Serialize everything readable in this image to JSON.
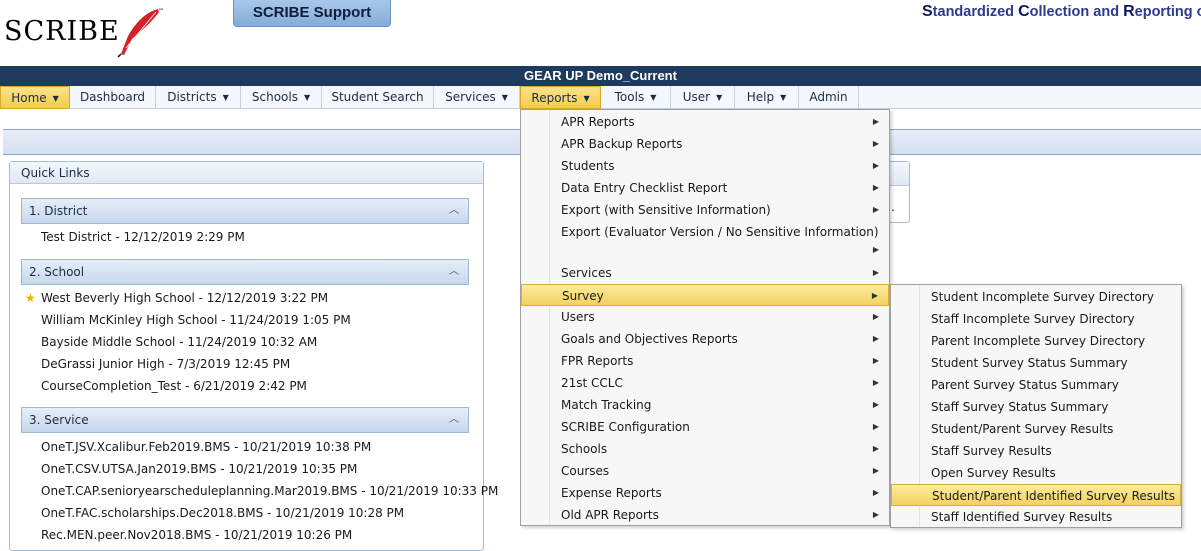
{
  "header": {
    "logo_text": "SCRIBE",
    "logo_tm": "™",
    "support_label": "SCRIBE Support",
    "tagline": [
      {
        "cap": "S",
        "rest": "tandardized "
      },
      {
        "cap": "C",
        "rest": "ollection and "
      },
      {
        "cap": "R",
        "rest": "eporting o"
      }
    ]
  },
  "title": "GEAR UP Demo_Current",
  "nav": {
    "items": [
      {
        "label": "Home",
        "arrow": "▼"
      },
      {
        "label": "Dashboard",
        "arrow": ""
      },
      {
        "label": "Districts",
        "arrow": "▼"
      },
      {
        "label": "Schools",
        "arrow": "▼"
      },
      {
        "label": "Student Search",
        "arrow": ""
      },
      {
        "label": "Services",
        "arrow": "▼"
      },
      {
        "label": "Reports",
        "arrow": "▼"
      },
      {
        "label": "Tools",
        "arrow": "▼"
      },
      {
        "label": "User",
        "arrow": "▼"
      },
      {
        "label": "Help",
        "arrow": "▼"
      },
      {
        "label": "Admin",
        "arrow": ""
      }
    ]
  },
  "quick_links": {
    "title": "Quick Links",
    "sections": [
      {
        "title": "1. District",
        "items": [
          "Test District - 12/12/2019 2:29 PM"
        ]
      },
      {
        "title": "2. School",
        "items": [
          "West Beverly High School - 12/12/2019 3:22 PM",
          "William McKinley High School - 11/24/2019 1:05 PM",
          "Bayside Middle School - 11/24/2019 10:32 AM",
          "DeGrassi Junior High - 7/3/2019 12:45 PM",
          "CourseCompletion_Test - 6/21/2019 2:42 PM"
        ]
      },
      {
        "title": "3. Service",
        "items": [
          "OneT.JSV.Xcalibur.Feb2019.BMS - 10/21/2019 10:38 PM",
          "OneT.CSV.UTSA.Jan2019.BMS - 10/21/2019 10:35 PM",
          "OneT.CAP.senioryearscheduleplanning.Mar2019.BMS - 10/21/2019 10:33 PM",
          "OneT.FAC.scholarships.Dec2018.BMS - 10/21/2019 10:28 PM",
          "Rec.MEN.peer.Nov2018.BMS - 10/21/2019 10:26 PM"
        ]
      }
    ],
    "collapse_glyph": "︿",
    "star_glyph": "★"
  },
  "behind_panel": {
    "trailing_text": "."
  },
  "reports_menu": {
    "items": [
      {
        "label": "APR Reports",
        "arrow": "▶"
      },
      {
        "label": "APR Backup Reports",
        "arrow": "▶"
      },
      {
        "label": "Students",
        "arrow": "▶"
      },
      {
        "label": "Data Entry Checklist Report",
        "arrow": "▶"
      },
      {
        "label": "Export (with Sensitive Information)",
        "arrow": "▶"
      },
      {
        "label": "Export (Evaluator Version / No Sensitive Information)",
        "arrow": ""
      },
      {
        "label": "",
        "arrow": "▶"
      },
      {
        "label": "Services",
        "arrow": "▶"
      },
      {
        "label": "Survey",
        "arrow": "▶"
      },
      {
        "label": "Users",
        "arrow": "▶"
      },
      {
        "label": "Goals and Objectives Reports",
        "arrow": "▶"
      },
      {
        "label": "FPR Reports",
        "arrow": "▶"
      },
      {
        "label": "21st CCLC",
        "arrow": "▶"
      },
      {
        "label": "Match Tracking",
        "arrow": "▶"
      },
      {
        "label": "SCRIBE Configuration",
        "arrow": "▶"
      },
      {
        "label": "Schools",
        "arrow": "▶"
      },
      {
        "label": "Courses",
        "arrow": "▶"
      },
      {
        "label": "Expense Reports",
        "arrow": "▶"
      },
      {
        "label": "Old APR Reports",
        "arrow": "▶"
      }
    ]
  },
  "survey_menu": {
    "items": [
      "Student Incomplete Survey Directory",
      "Staff Incomplete Survey Directory",
      "Parent Incomplete Survey Directory",
      "Student Survey Status Summary",
      "Parent Survey Status Summary",
      "Staff Survey Status Summary",
      "Student/Parent Survey Results",
      "Staff Survey Results",
      "Open Survey Results",
      "Student/Parent Identified Survey Results",
      "Staff Identified Survey Results"
    ]
  }
}
